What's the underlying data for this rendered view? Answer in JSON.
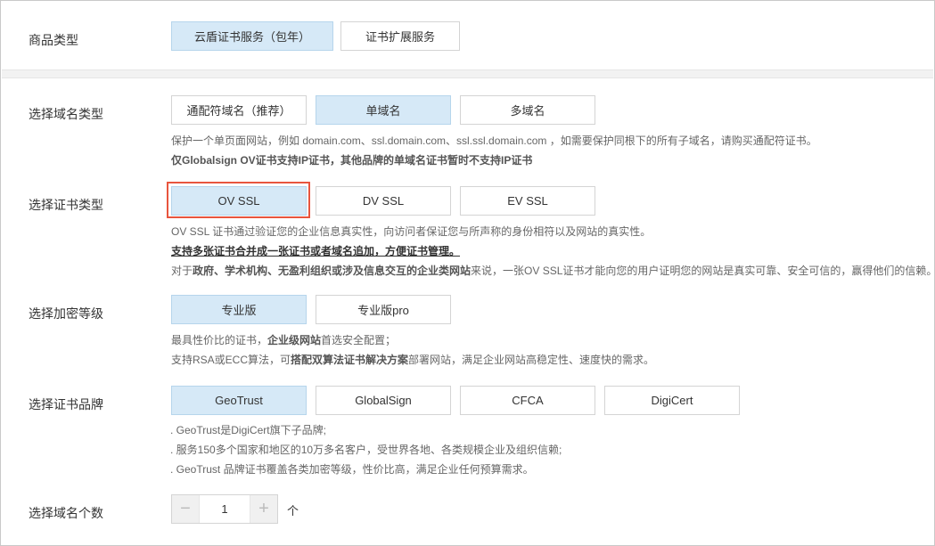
{
  "product_type": {
    "label": "商品类型",
    "options": [
      "云盾证书服务（包年）",
      "证书扩展服务"
    ],
    "selected": 0
  },
  "domain_type": {
    "label": "选择域名类型",
    "options": [
      "通配符域名（推荐）",
      "单域名",
      "多域名"
    ],
    "selected": 1,
    "desc_line1": "保护一个单页面网站，例如 domain.com、ssl.domain.com、ssl.ssl.domain.com ，如需要保护同根下的所有子域名，请购买通配符证书。",
    "desc_line2": "仅Globalsign OV证书支持IP证书，其他品牌的单域名证书暂时不支持IP证书"
  },
  "cert_type": {
    "label": "选择证书类型",
    "options": [
      "OV SSL",
      "DV SSL",
      "EV SSL"
    ],
    "selected": 0,
    "desc_line1": "OV SSL 证书通过验证您的企业信息真实性，向访问者保证您与所声称的身份相符以及网站的真实性。",
    "desc_line2": "支持多张证书合并成一张证书或者域名追加，方便证书管理。",
    "desc_line3_a": "对于",
    "desc_line3_b": "政府、学术机构、无盈利组织或涉及信息交互的企业类网站",
    "desc_line3_c": "来说，一张OV SSL证书才能向您的用户证明您的网站是真实可靠、安全可信的，赢得他们的信赖。"
  },
  "encryption_level": {
    "label": "选择加密等级",
    "options": [
      "专业版",
      "专业版pro"
    ],
    "selected": 0,
    "desc_line1_a": "最具性价比的证书，",
    "desc_line1_b": "企业级网站",
    "desc_line1_c": "首选安全配置；",
    "desc_line2_a": "支持RSA或ECC算法，可",
    "desc_line2_b": "搭配双算法证书解决方案",
    "desc_line2_c": "部署网站，满足企业网站高稳定性、速度快的需求。"
  },
  "cert_brand": {
    "label": "选择证书品牌",
    "options": [
      "GeoTrust",
      "GlobalSign",
      "CFCA",
      "DigiCert"
    ],
    "selected": 0,
    "desc_line1": ". GeoTrust是DigiCert旗下子品牌;",
    "desc_line2": ". 服务150多个国家和地区的10万多名客户，受世界各地、各类规模企业及组织信赖;",
    "desc_line3": ". GeoTrust 品牌证书覆盖各类加密等级，性价比高，满足企业任何预算需求。"
  },
  "domain_count": {
    "label": "选择域名个数",
    "minus": "−",
    "value": "1",
    "plus": "+",
    "unit": "个"
  },
  "colors": {
    "selected_bg": "#d6e9f7",
    "highlight": "#e8553e"
  }
}
